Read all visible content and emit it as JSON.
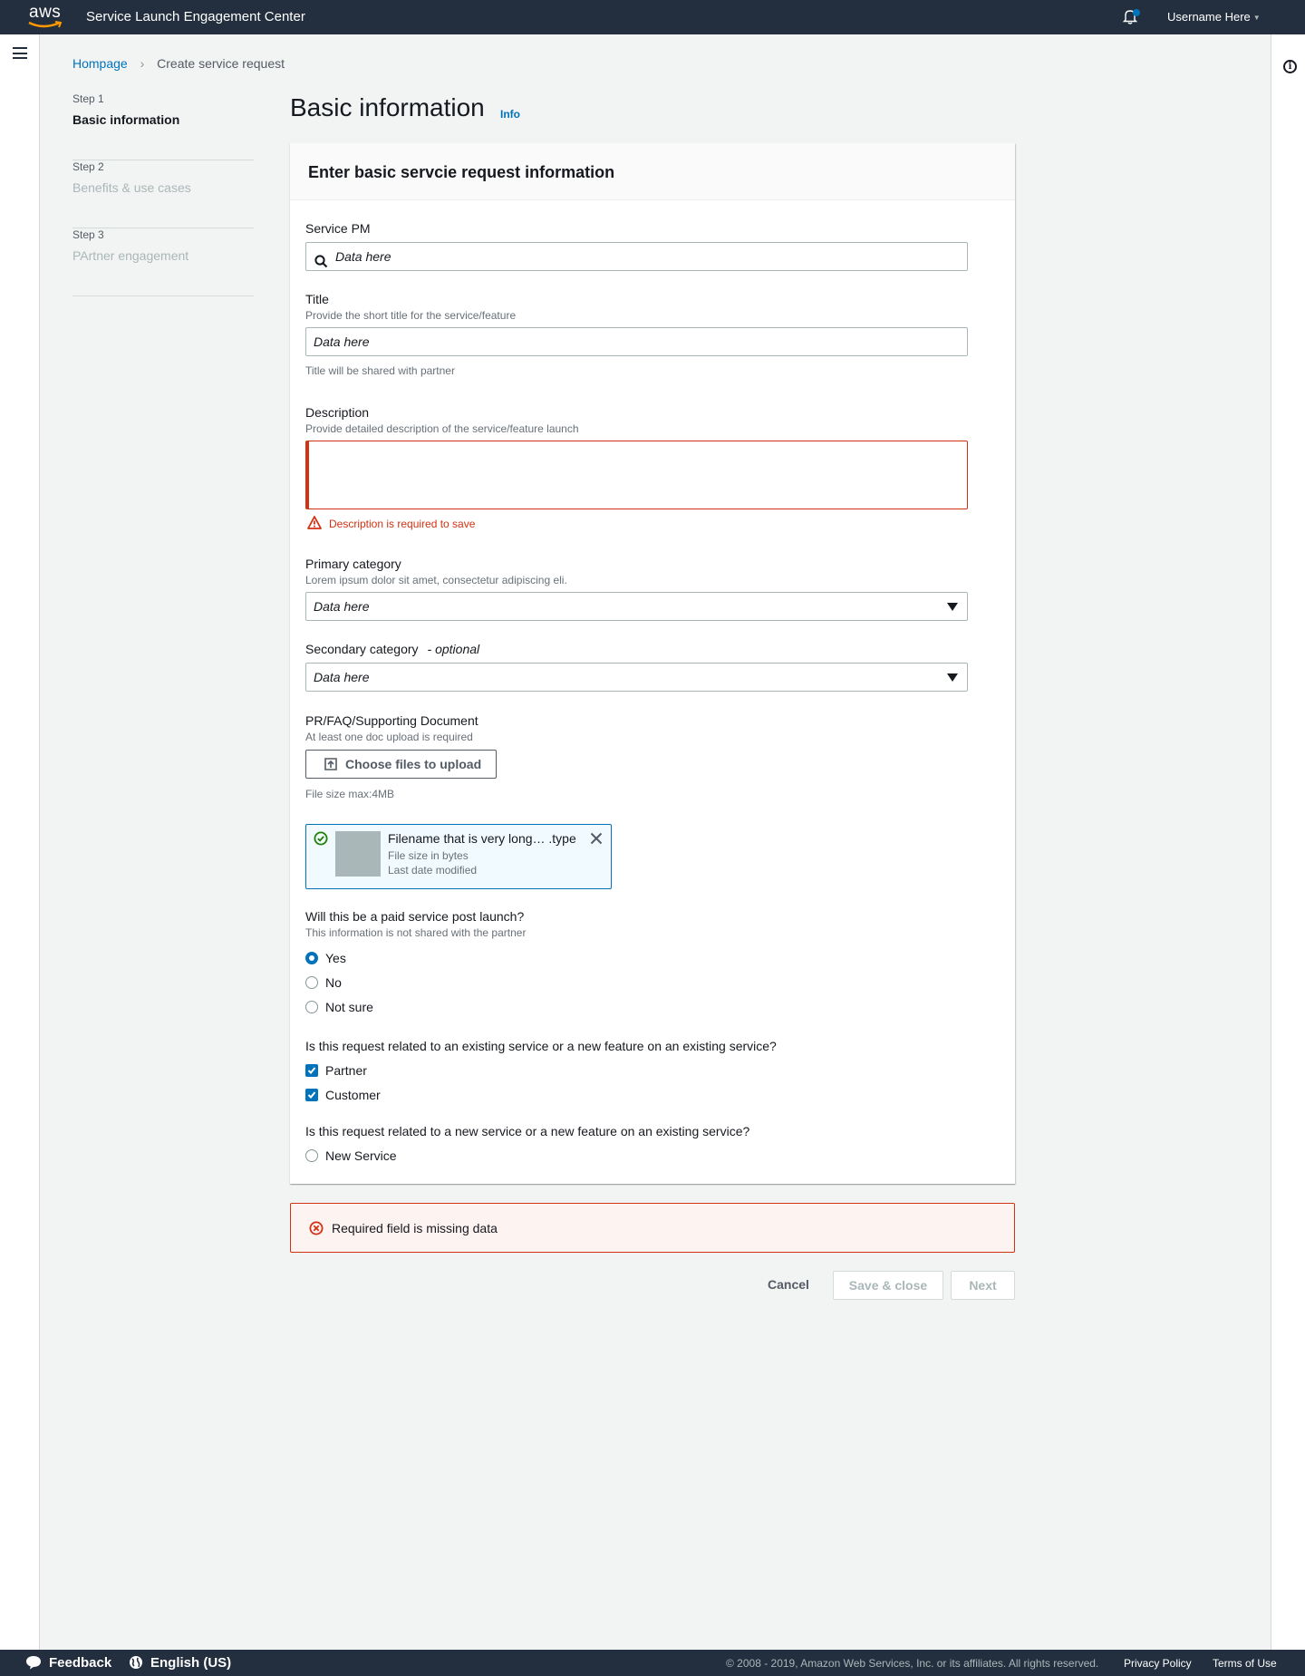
{
  "header": {
    "logo_text": "aws",
    "app_title": "Service Launch Engagement Center",
    "username": "Username Here"
  },
  "breadcrumb": {
    "home": "Hompage",
    "current": "Create service request"
  },
  "steps": [
    {
      "label": "Step 1",
      "name": "Basic information"
    },
    {
      "label": "Step 2",
      "name": "Benefits & use cases"
    },
    {
      "label": "Step 3",
      "name": "PArtner engagement"
    }
  ],
  "page": {
    "title": "Basic information",
    "info": "Info"
  },
  "card": {
    "header": "Enter basic servcie request information"
  },
  "form": {
    "service_pm": {
      "label": "Service PM",
      "value": "Data here"
    },
    "title": {
      "label": "Title",
      "description": "Provide the short title for the service/feature",
      "value": "Data here",
      "hint": "Title will be shared with partner"
    },
    "description": {
      "label": "Description",
      "description": "Provide detailed description of the service/feature launch",
      "value": "",
      "error": "Description is required to save"
    },
    "primary_category": {
      "label": "Primary category",
      "description": "Lorem ipsum dolor sit amet, consectetur adipiscing eli.",
      "value": "Data here"
    },
    "secondary_category": {
      "label": "Secondary category",
      "optional": "- optional",
      "value": "Data here"
    },
    "document": {
      "label": "PR/FAQ/Supporting Document",
      "description": "At least one doc upload is required",
      "button": "Choose files to upload",
      "hint": "File size max:4MB"
    },
    "file": {
      "name": "Filename that is very long… .type",
      "size": "File size in bytes",
      "date": "Last date modified"
    },
    "paid": {
      "label": "Will this be a paid service post launch?",
      "description": "This information is not shared with the partner",
      "options": [
        "Yes",
        "No",
        "Not sure"
      ],
      "selected": "Yes"
    },
    "related_existing": {
      "label": "Is this request related to an existing service or a new feature on an existing service?",
      "options": [
        "Partner",
        "Customer"
      ],
      "checked": [
        "Partner",
        "Customer"
      ]
    },
    "related_new": {
      "label": "Is this request related to a new service or a new feature on an existing service?",
      "options": [
        "New Service"
      ]
    }
  },
  "alert": {
    "message": "Required field is missing data"
  },
  "actions": {
    "cancel": "Cancel",
    "save": "Save & close",
    "next": "Next"
  },
  "footer": {
    "feedback": "Feedback",
    "language": "English (US)",
    "copyright": "© 2008 - 2019, Amazon Web Services, Inc. or its affiliates. All rights reserved.",
    "privacy": "Privacy Policy",
    "terms": "Terms of Use"
  },
  "colors": {
    "header_bg": "#232f3e",
    "link": "#0073bb",
    "error": "#d13212",
    "accent": "#0073bb"
  }
}
